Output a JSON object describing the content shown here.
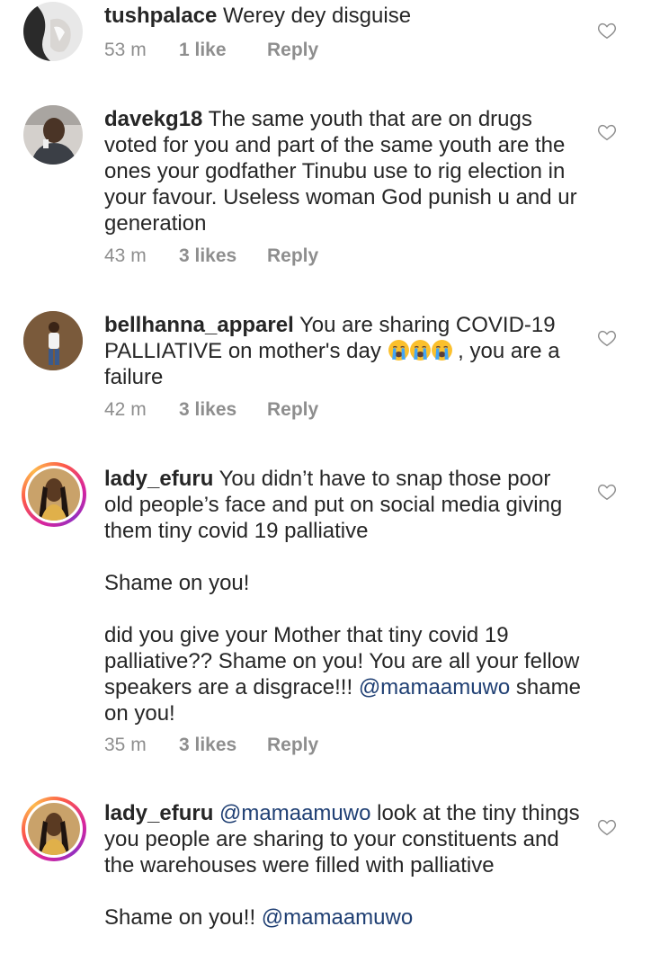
{
  "comments": [
    {
      "username": "tushpalace",
      "text": " Werey dey disguise",
      "time": "53 m",
      "likes": "1 like",
      "reply": "Reply"
    },
    {
      "username": "davekg18",
      "text": " The same youth that are on drugs voted for you and part of the same youth are the ones your godfather Tinubu use to rig election in your favour. Useless woman God punish u and ur generation",
      "time": "43 m",
      "likes": "3 likes",
      "reply": "Reply"
    },
    {
      "username": "bellhanna_apparel",
      "text_before_emoji": " You are sharing COVID-19 PALLIATIVE on mother's day ",
      "emoji": "crying-face x3",
      "text_after_emoji": " , you are a failure",
      "time": "42 m",
      "likes": "3 likes",
      "reply": "Reply"
    },
    {
      "username": "lady_efuru",
      "text": " You didn’t have to snap those poor old people’s face and put on social media giving them tiny covid 19 palliative\n\nShame on you!\n\ndid you give your Mother that tiny covid 19 palliative?? Shame on you! You are all your fellow speakers are a disgrace!!! ",
      "mention": "@mamaamuwo",
      "text_end": " shame on you!",
      "time": "35 m",
      "likes": "3 likes",
      "reply": "Reply"
    },
    {
      "username": "lady_efuru",
      "mention_start": " @mamaamuwo",
      "text": " look at the tiny things you people are sharing to your constituents and the warehouses were filled with palliative\n\nShame on you!! ",
      "mention_end": "@mamaamuwo"
    }
  ],
  "icons": {
    "like": "heart-outline-icon",
    "emoji": "loudly-crying-face-icon"
  },
  "colors": {
    "text": "#262626",
    "meta": "#8e8e8e",
    "mention": "#1f3f73",
    "story_ring": "#d6249f"
  }
}
